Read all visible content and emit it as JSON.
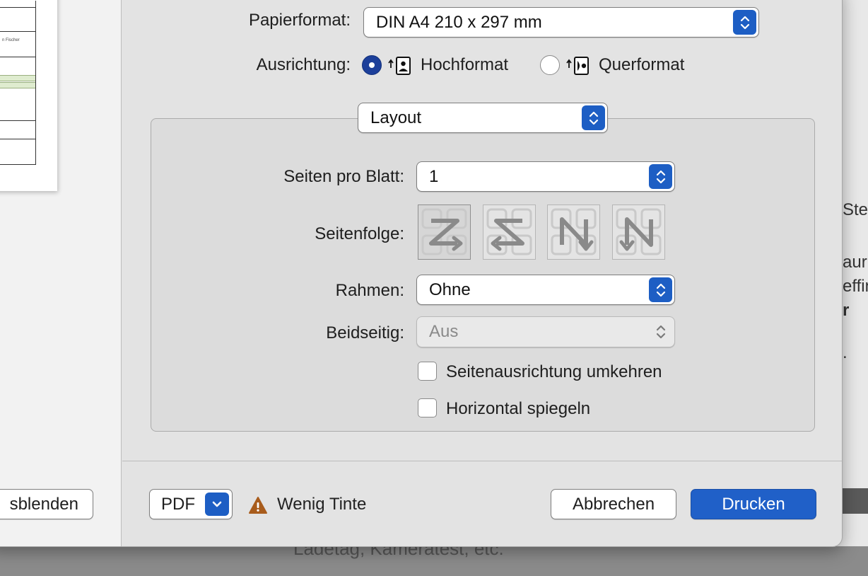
{
  "background": {
    "right_fragments": [
      "Ste",
      "aur",
      "effin",
      "r",
      "."
    ],
    "bottom_text": "Ladetag, Kameratest, etc."
  },
  "preview": {
    "cell_text": "n Fischer",
    "details_button_label": "sblenden"
  },
  "paper": {
    "label": "Papierformat:",
    "value": "DIN A4 210 x 297 mm"
  },
  "orientation": {
    "label": "Ausrichtung:",
    "options": [
      "Hochformat",
      "Querformat"
    ],
    "selected": "Hochformat"
  },
  "section": {
    "value": "Layout"
  },
  "layout": {
    "pages_per_sheet_label": "Seiten pro Blatt:",
    "pages_per_sheet_value": "1",
    "page_order_label": "Seitenfolge:",
    "border_label": "Rahmen:",
    "border_value": "Ohne",
    "duplex_label": "Beidseitig:",
    "duplex_value": "Aus",
    "reverse_orientation_label": "Seitenausrichtung umkehren",
    "reverse_orientation_checked": false,
    "flip_horizontal_label": "Horizontal spiegeln",
    "flip_horizontal_checked": false
  },
  "footer": {
    "pdf_label": "PDF",
    "warning_text": "Wenig Tinte",
    "cancel_label": "Abbrechen",
    "print_label": "Drucken"
  },
  "colors": {
    "accent": "#1d5ec4",
    "radio_selected": "#1c3f9a",
    "warning": "#a85c1c"
  },
  "icons": {
    "stepper": "chevron-up-down-icon",
    "portrait": "portrait-page-icon",
    "landscape": "landscape-page-icon",
    "warning": "warning-triangle-icon",
    "pdf_menu": "chevron-down-icon"
  }
}
